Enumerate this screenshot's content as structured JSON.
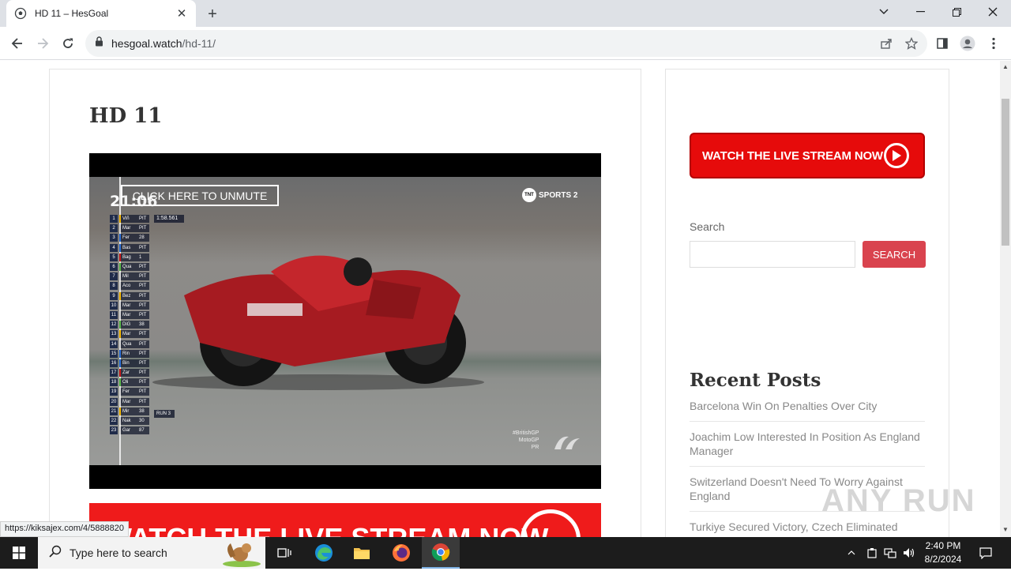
{
  "browser": {
    "tab_title": "HD 11 – HesGoal",
    "url_host": "hesgoal.watch",
    "url_path": "/hd-11/",
    "status_url": "https://kiksajex.com/4/5888820"
  },
  "page": {
    "title": "HD 11",
    "unmute_label": "CLICK HERE TO UNMUTE",
    "video": {
      "clock": "21:06",
      "lap_time": "1:58.561",
      "run_label": "RUN 3",
      "broadcaster": "SPORTS 2",
      "broadcaster_badge": "TNT",
      "event_tag_1": "#BritishGP",
      "event_tag_2": "MotoGP",
      "event_tag_3": "PR",
      "leaderboard": [
        {
          "pos": "1",
          "name": "Viñ",
          "gap": "PIT"
        },
        {
          "pos": "2",
          "name": "Mar",
          "gap": "PIT"
        },
        {
          "pos": "3",
          "name": "Fer",
          "gap": "28"
        },
        {
          "pos": "4",
          "name": "Bas",
          "gap": "PIT"
        },
        {
          "pos": "5",
          "name": "Bag",
          "gap": "1"
        },
        {
          "pos": "6",
          "name": "Qua",
          "gap": "PIT"
        },
        {
          "pos": "7",
          "name": "Mil",
          "gap": "PIT"
        },
        {
          "pos": "8",
          "name": "Aco",
          "gap": "PIT"
        },
        {
          "pos": "9",
          "name": "Bez",
          "gap": "PIT"
        },
        {
          "pos": "10",
          "name": "Mar",
          "gap": "PIT"
        },
        {
          "pos": "11",
          "name": "Mar",
          "gap": "PIT"
        },
        {
          "pos": "12",
          "name": "DiG",
          "gap": "38"
        },
        {
          "pos": "13",
          "name": "Mar",
          "gap": "PIT"
        },
        {
          "pos": "14",
          "name": "Qua",
          "gap": "PIT"
        },
        {
          "pos": "15",
          "name": "Rin",
          "gap": "PIT"
        },
        {
          "pos": "16",
          "name": "Bin",
          "gap": "PIT"
        },
        {
          "pos": "17",
          "name": "Zar",
          "gap": "PIT"
        },
        {
          "pos": "18",
          "name": "Oli",
          "gap": "PIT"
        },
        {
          "pos": "19",
          "name": "Fer",
          "gap": "PIT"
        },
        {
          "pos": "20",
          "name": "Mar",
          "gap": "PIT"
        },
        {
          "pos": "21",
          "name": "Mir",
          "gap": "38"
        },
        {
          "pos": "22",
          "name": "Nak",
          "gap": "30"
        },
        {
          "pos": "23",
          "name": "Gar",
          "gap": "87"
        }
      ]
    },
    "bottom_banner_text": "WATCH THE LIVE STREAM NOW"
  },
  "sidebar": {
    "watch_button_label": "WATCH THE LIVE STREAM NOW",
    "search_label": "Search",
    "search_input_value": "",
    "search_button_label": "SEARCH",
    "recent_title": "Recent Posts",
    "posts": [
      "Barcelona Win On Penalties Over City",
      "Joachim Low Interested In Position As England Manager",
      "Switzerland Doesn't Need To Worry Against England",
      "Turkiye Secured Victory, Czech Eliminated"
    ]
  },
  "watermark": "ANY RUN",
  "taskbar": {
    "search_placeholder": "Type here to search",
    "time": "2:40 PM",
    "date": "8/2/2024"
  }
}
